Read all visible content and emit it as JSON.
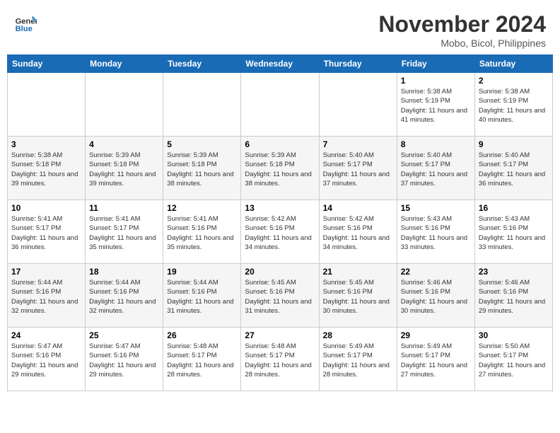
{
  "header": {
    "logo_line1": "General",
    "logo_line2": "Blue",
    "month_title": "November 2024",
    "location": "Mobo, Bicol, Philippines"
  },
  "weekdays": [
    "Sunday",
    "Monday",
    "Tuesday",
    "Wednesday",
    "Thursday",
    "Friday",
    "Saturday"
  ],
  "weeks": [
    [
      {
        "day": "",
        "detail": ""
      },
      {
        "day": "",
        "detail": ""
      },
      {
        "day": "",
        "detail": ""
      },
      {
        "day": "",
        "detail": ""
      },
      {
        "day": "",
        "detail": ""
      },
      {
        "day": "1",
        "detail": "Sunrise: 5:38 AM\nSunset: 5:19 PM\nDaylight: 11 hours and 41 minutes."
      },
      {
        "day": "2",
        "detail": "Sunrise: 5:38 AM\nSunset: 5:19 PM\nDaylight: 11 hours and 40 minutes."
      }
    ],
    [
      {
        "day": "3",
        "detail": "Sunrise: 5:38 AM\nSunset: 5:18 PM\nDaylight: 11 hours and 39 minutes."
      },
      {
        "day": "4",
        "detail": "Sunrise: 5:39 AM\nSunset: 5:18 PM\nDaylight: 11 hours and 39 minutes."
      },
      {
        "day": "5",
        "detail": "Sunrise: 5:39 AM\nSunset: 5:18 PM\nDaylight: 11 hours and 38 minutes."
      },
      {
        "day": "6",
        "detail": "Sunrise: 5:39 AM\nSunset: 5:18 PM\nDaylight: 11 hours and 38 minutes."
      },
      {
        "day": "7",
        "detail": "Sunrise: 5:40 AM\nSunset: 5:17 PM\nDaylight: 11 hours and 37 minutes."
      },
      {
        "day": "8",
        "detail": "Sunrise: 5:40 AM\nSunset: 5:17 PM\nDaylight: 11 hours and 37 minutes."
      },
      {
        "day": "9",
        "detail": "Sunrise: 5:40 AM\nSunset: 5:17 PM\nDaylight: 11 hours and 36 minutes."
      }
    ],
    [
      {
        "day": "10",
        "detail": "Sunrise: 5:41 AM\nSunset: 5:17 PM\nDaylight: 11 hours and 36 minutes."
      },
      {
        "day": "11",
        "detail": "Sunrise: 5:41 AM\nSunset: 5:17 PM\nDaylight: 11 hours and 35 minutes."
      },
      {
        "day": "12",
        "detail": "Sunrise: 5:41 AM\nSunset: 5:16 PM\nDaylight: 11 hours and 35 minutes."
      },
      {
        "day": "13",
        "detail": "Sunrise: 5:42 AM\nSunset: 5:16 PM\nDaylight: 11 hours and 34 minutes."
      },
      {
        "day": "14",
        "detail": "Sunrise: 5:42 AM\nSunset: 5:16 PM\nDaylight: 11 hours and 34 minutes."
      },
      {
        "day": "15",
        "detail": "Sunrise: 5:43 AM\nSunset: 5:16 PM\nDaylight: 11 hours and 33 minutes."
      },
      {
        "day": "16",
        "detail": "Sunrise: 5:43 AM\nSunset: 5:16 PM\nDaylight: 11 hours and 33 minutes."
      }
    ],
    [
      {
        "day": "17",
        "detail": "Sunrise: 5:44 AM\nSunset: 5:16 PM\nDaylight: 11 hours and 32 minutes."
      },
      {
        "day": "18",
        "detail": "Sunrise: 5:44 AM\nSunset: 5:16 PM\nDaylight: 11 hours and 32 minutes."
      },
      {
        "day": "19",
        "detail": "Sunrise: 5:44 AM\nSunset: 5:16 PM\nDaylight: 11 hours and 31 minutes."
      },
      {
        "day": "20",
        "detail": "Sunrise: 5:45 AM\nSunset: 5:16 PM\nDaylight: 11 hours and 31 minutes."
      },
      {
        "day": "21",
        "detail": "Sunrise: 5:45 AM\nSunset: 5:16 PM\nDaylight: 11 hours and 30 minutes."
      },
      {
        "day": "22",
        "detail": "Sunrise: 5:46 AM\nSunset: 5:16 PM\nDaylight: 11 hours and 30 minutes."
      },
      {
        "day": "23",
        "detail": "Sunrise: 5:46 AM\nSunset: 5:16 PM\nDaylight: 11 hours and 29 minutes."
      }
    ],
    [
      {
        "day": "24",
        "detail": "Sunrise: 5:47 AM\nSunset: 5:16 PM\nDaylight: 11 hours and 29 minutes."
      },
      {
        "day": "25",
        "detail": "Sunrise: 5:47 AM\nSunset: 5:16 PM\nDaylight: 11 hours and 29 minutes."
      },
      {
        "day": "26",
        "detail": "Sunrise: 5:48 AM\nSunset: 5:17 PM\nDaylight: 11 hours and 28 minutes."
      },
      {
        "day": "27",
        "detail": "Sunrise: 5:48 AM\nSunset: 5:17 PM\nDaylight: 11 hours and 28 minutes."
      },
      {
        "day": "28",
        "detail": "Sunrise: 5:49 AM\nSunset: 5:17 PM\nDaylight: 11 hours and 28 minutes."
      },
      {
        "day": "29",
        "detail": "Sunrise: 5:49 AM\nSunset: 5:17 PM\nDaylight: 11 hours and 27 minutes."
      },
      {
        "day": "30",
        "detail": "Sunrise: 5:50 AM\nSunset: 5:17 PM\nDaylight: 11 hours and 27 minutes."
      }
    ]
  ]
}
